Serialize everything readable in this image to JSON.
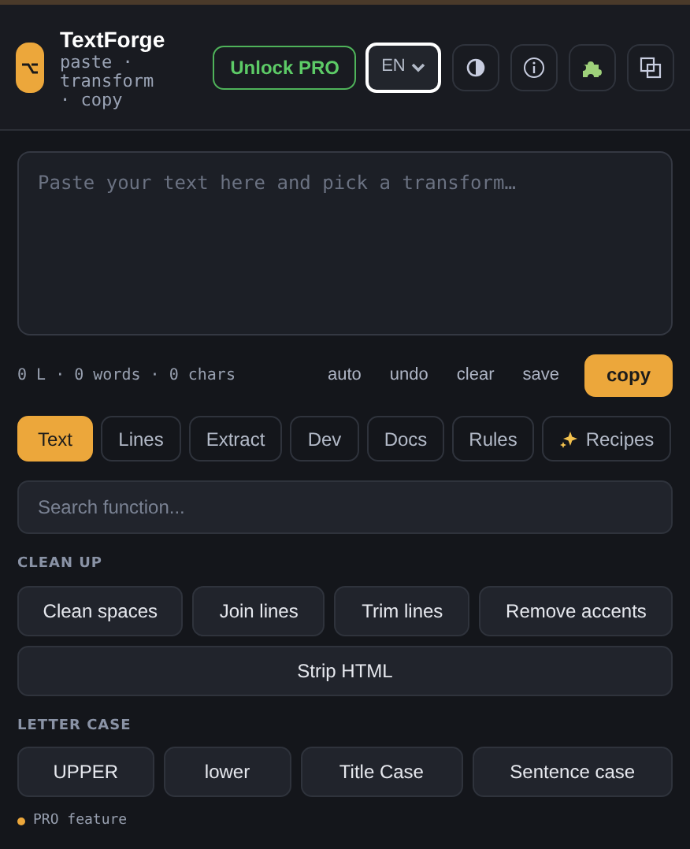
{
  "app": {
    "title": "TextForge",
    "tagline": "paste · transform · copy"
  },
  "header": {
    "unlock_button": "Unlock PRO",
    "language": {
      "value": "EN"
    }
  },
  "editor": {
    "placeholder": "Paste your text here and pick a transform…"
  },
  "stats": "0 L · 0 words · 0 chars",
  "actions": [
    {
      "label": "auto",
      "kind": "plain"
    },
    {
      "label": "undo",
      "kind": "plain"
    },
    {
      "label": "clear",
      "kind": "plain"
    },
    {
      "label": "save",
      "kind": "plain"
    },
    {
      "label": "copy",
      "kind": "primary"
    }
  ],
  "tabs": [
    {
      "label": "Text",
      "selected": true
    },
    {
      "label": "Lines",
      "selected": false
    },
    {
      "label": "Extract",
      "selected": false
    },
    {
      "label": "Dev",
      "selected": false
    },
    {
      "label": "Docs",
      "selected": false
    },
    {
      "label": "Rules",
      "selected": false
    },
    {
      "label": "Recipes",
      "selected": false,
      "kind": "sparkle"
    }
  ],
  "search": {
    "placeholder": "Search function..."
  },
  "sections": [
    {
      "title": "CLEAN UP",
      "rows": [
        [
          "Clean spaces",
          "Join lines",
          "Trim lines",
          "Remove accents"
        ],
        [
          "Strip HTML"
        ]
      ]
    },
    {
      "title": "LETTER CASE",
      "rows": [
        [
          "UPPER",
          "lower",
          "Title Case",
          "Sentence case"
        ]
      ]
    }
  ],
  "legend": "PRO feature"
}
